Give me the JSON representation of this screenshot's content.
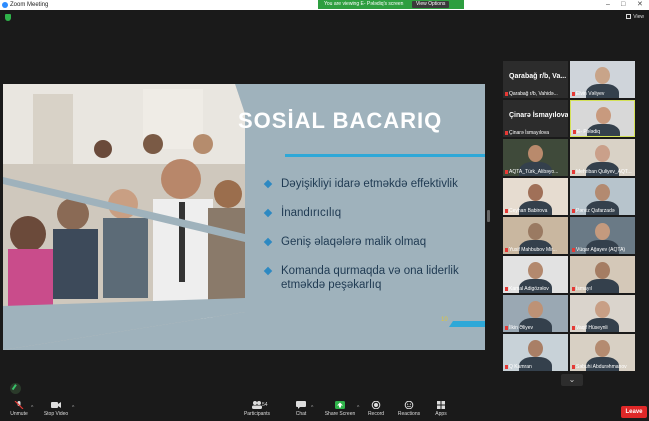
{
  "window": {
    "title": "Zoom Meeting",
    "controls": [
      "–",
      "□",
      "✕"
    ]
  },
  "banner": {
    "text": "You are viewing E- Pələdiq's screen",
    "view_options": "View Options"
  },
  "view_button": "View",
  "slide": {
    "title": "SOSİAL BACARIQ",
    "bullets": [
      "Dəyişikliyi idarə etməkdə effektivlik",
      "İnandırıcılıq",
      "Geniş əlaqələrə malik olmaq",
      "Komanda qurmaqda və ona liderlik etməkdə peşəkarlıq"
    ],
    "page_marker": "10"
  },
  "gallery": {
    "tiles": [
      {
        "big": "Qarabağ r/b, Va...",
        "name": "Qarabağ r/b, Vahidə..."
      },
      {
        "big": "",
        "name": "Elvin Vəliyev"
      },
      {
        "big": "Çinarə İsmayılova",
        "name": "Çinarə İsmayılova"
      },
      {
        "big": "",
        "name": "E- Pələdiq"
      },
      {
        "big": "",
        "name": "AQTA_Türk_Alibəyo..."
      },
      {
        "big": "",
        "name": "Mehriban Quliyev_AQT..."
      },
      {
        "big": "",
        "name": "Ceyhan Babirova"
      },
      {
        "big": "",
        "name": "Pərviz Qafarzadə"
      },
      {
        "big": "",
        "name": "Yusif Mahbubov Mir..."
      },
      {
        "big": "",
        "name": "Vüqar Ağayev (AQTA)"
      },
      {
        "big": "",
        "name": "Kamal Adigözəlov"
      },
      {
        "big": "",
        "name": "İsmayıl"
      },
      {
        "big": "",
        "name": "İlkin Əliyev"
      },
      {
        "big": "",
        "name": "Vaqif Hüseynli"
      },
      {
        "big": "",
        "name": "Q Kamran"
      },
      {
        "big": "",
        "name": "Səbuhi Abdurəhmanov"
      }
    ],
    "more": "⌄"
  },
  "toolbar": {
    "unmute": "Unmute",
    "stop_video": "Stop Video",
    "participants": "Participants",
    "participants_count": "54",
    "chat": "Chat",
    "share_screen": "Share Screen",
    "record": "Record",
    "reactions": "Reactions",
    "apps": "Apps",
    "leave": "Leave"
  },
  "colors": {
    "accent": "#2d8cff",
    "banner_green": "#2e9e3f",
    "leave_red": "#e02828",
    "slide_bg": "#9fb2bc"
  }
}
